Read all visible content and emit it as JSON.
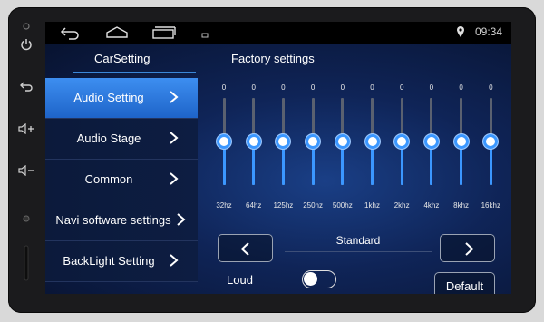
{
  "status": {
    "time": "09:34"
  },
  "tabs": {
    "carsetting": "CarSetting",
    "factory": "Factory settings"
  },
  "menu": {
    "items": [
      {
        "label": "Audio Setting"
      },
      {
        "label": "Audio Stage"
      },
      {
        "label": "Common"
      },
      {
        "label": "Navi software settings"
      },
      {
        "label": "BackLight Setting"
      }
    ]
  },
  "equalizer": {
    "bands": [
      {
        "freq": "32hz",
        "value": "0"
      },
      {
        "freq": "64hz",
        "value": "0"
      },
      {
        "freq": "125hz",
        "value": "0"
      },
      {
        "freq": "250hz",
        "value": "0"
      },
      {
        "freq": "500hz",
        "value": "0"
      },
      {
        "freq": "1khz",
        "value": "0"
      },
      {
        "freq": "2khz",
        "value": "0"
      },
      {
        "freq": "4khz",
        "value": "0"
      },
      {
        "freq": "8khz",
        "value": "0"
      },
      {
        "freq": "16khz",
        "value": "0"
      }
    ],
    "preset": "Standard"
  },
  "controls": {
    "loud_label": "Loud",
    "loud_on": false,
    "default_label": "Default"
  },
  "colors": {
    "accent": "#3b97ff",
    "active_menu": "#2f7fe0"
  }
}
